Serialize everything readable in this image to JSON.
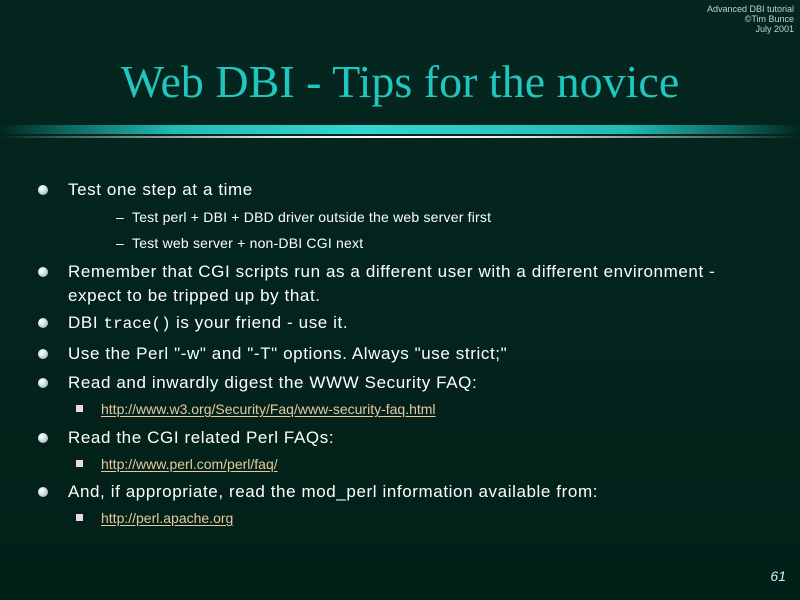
{
  "header": {
    "corner_lines": [
      "Advanced DBI tutorial",
      "©Tim Bunce",
      "July 2001"
    ]
  },
  "title": "Web DBI - Tips for the novice",
  "bullets": [
    {
      "text": "Test one step at a time",
      "sub": [
        {
          "type": "dash",
          "text": "Test perl + DBI + DBD driver outside the web server first"
        },
        {
          "type": "dash",
          "text": "Test web server + non-DBI CGI next"
        }
      ]
    },
    {
      "text": "Remember that CGI scripts run as a different user with a different environment - expect to be tripped up by that.",
      "sub": []
    },
    {
      "text_prefix": "DBI ",
      "text_code": "trace()",
      "text_suffix": " is your friend - use it.",
      "sub": []
    },
    {
      "text": "Use the Perl \"-w\" and \"-T\" options. Always \"use strict;\"",
      "sub": []
    },
    {
      "text": "Read and inwardly digest the WWW Security FAQ:",
      "sub": [
        {
          "type": "link",
          "text": "http://www.w3.org/Security/Faq/www-security-faq.html"
        }
      ]
    },
    {
      "text": "Read the CGI related Perl FAQs:",
      "sub": [
        {
          "type": "link",
          "text": "http://www.perl.com/perl/faq/"
        }
      ]
    },
    {
      "text": "And, if appropriate, read the mod_perl information available from:",
      "sub": [
        {
          "type": "link",
          "text": "http://perl.apache.org"
        }
      ]
    }
  ],
  "page_number": "61",
  "colors": {
    "title": "#20c7c0",
    "background": "#03241d",
    "link": "#e7c8a0",
    "text": "#ffffff"
  },
  "icons": {
    "bullet_l1": "round-bullet-icon",
    "bullet_link": "square-bullet-icon"
  }
}
